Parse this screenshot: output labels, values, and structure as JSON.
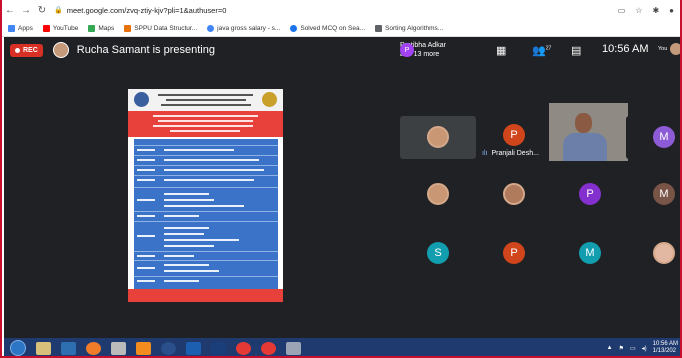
{
  "browser": {
    "url": "meet.google.com/zvq-ztiy-kjv?pli=1&authuser=0",
    "nav_icons": [
      "back-icon",
      "forward-icon",
      "reload-icon"
    ],
    "right_icons": [
      "cast-icon",
      "star-icon",
      "extension-icon",
      "profile-icon"
    ]
  },
  "bookmarks": [
    {
      "label": "Apps",
      "color": "#4285f4"
    },
    {
      "label": "YouTube",
      "color": "#ff0000"
    },
    {
      "label": "Maps",
      "color": "#34a853"
    },
    {
      "label": "SPPU Data Structur...",
      "color": "#e8710a"
    },
    {
      "label": "java gross salary - s...",
      "color": "#4285f4"
    },
    {
      "label": "Solved MCQ on Sea...",
      "color": "#1a73e8"
    },
    {
      "label": "Sorting Algorithms...",
      "color": "#5f6368"
    }
  ],
  "meet": {
    "rec_label": "REC",
    "presenter_text": "Rucha Samant is presenting",
    "participants_name": "Pratibha Adkar",
    "participants_more": "and 13 more",
    "participant_initial": "P",
    "participant_count": "27",
    "clock": "10:56 AM",
    "you_label": "You",
    "speaker_label": "Pranjali Desh...",
    "tiles": [
      {
        "type": "photo"
      },
      {
        "type": "letter",
        "letter": "P",
        "color": "#d0451b"
      },
      {
        "type": "letter",
        "letter": "M",
        "color": "#8e5bd6"
      },
      {
        "type": "photo"
      },
      {
        "type": "photo"
      },
      {
        "type": "letter",
        "letter": "P",
        "color": "#8430ce"
      },
      {
        "type": "letter",
        "letter": "M",
        "color": "#795548"
      },
      {
        "type": "letter",
        "letter": "S",
        "color": "#129eaf"
      },
      {
        "type": "letter",
        "letter": "P",
        "color": "#d0451b"
      },
      {
        "type": "letter",
        "letter": "M",
        "color": "#129eaf"
      },
      {
        "type": "photo"
      }
    ]
  },
  "taskbar": {
    "time": "10:56 AM",
    "date": "1/13/202"
  }
}
